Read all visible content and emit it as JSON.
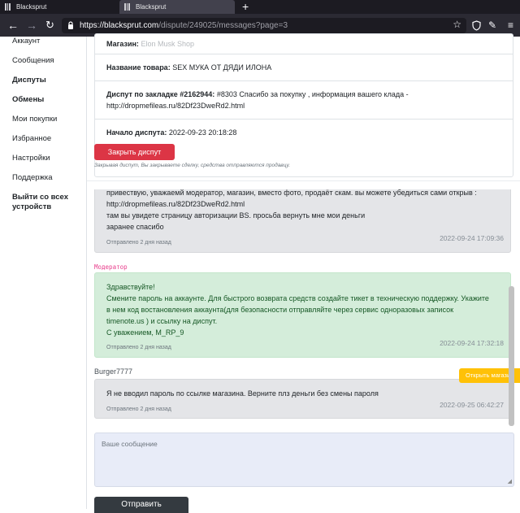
{
  "browser": {
    "tabs": [
      {
        "title": "Blacksprut"
      },
      {
        "title": "Blacksprut"
      }
    ],
    "url_host": "https://blacksprut.com",
    "url_path": "/dispute/249025/messages?page=3"
  },
  "sidebar": {
    "items": [
      {
        "label": "Аккаунт"
      },
      {
        "label": "Сообщения"
      },
      {
        "label": "Диспуты"
      },
      {
        "label": "Обмены"
      },
      {
        "label": "Мои покупки"
      },
      {
        "label": "Избранное"
      },
      {
        "label": "Настройки"
      },
      {
        "label": "Поддержка"
      },
      {
        "label": "Выйти со всех устройств"
      }
    ]
  },
  "dispute": {
    "shop_label": "Магазин:",
    "shop_value": "Elon Musk Shop",
    "product_label": "Название товара:",
    "product_value": "SEX МУКА ОТ ДЯДИ ИЛОНА",
    "bookmark_label": "Диспут по закладке #2162944:",
    "bookmark_value": "#8303 Спасибо за покупку , информация вашего клада - http://dropmefileas.ru/82Df23DweRd2.html",
    "start_label": "Начало диспута:",
    "start_value": "2022-09-23 20:18:28",
    "close_button": "Закрыть диспут",
    "close_hint": "Закрывая диспут, Вы закрываете сделку, средства отправляются продавцу."
  },
  "messages": [
    {
      "lines": [
        "привествую, уважаемй модератор, магазин, вместо фото, продаёт скам. вы можете убедиться сами открыв :",
        "http://dropmefileas.ru/82Df23DweRd2.html",
        "там вы увидете страницу авторизации BS. просьба вернуть мне мои деньги",
        "заранее спасибо"
      ],
      "status": "Отправлено 2 дня назад",
      "date": "2022-09-24 17:09:36"
    },
    {
      "author": "Модератор",
      "lines": [
        "Здравствуйте!",
        "Смените пароль на аккаунте. Для быстрого возврата средств создайте тикет в техническую поддержку. Укажите",
        "в нем код востановления аккаунта(для безопасности отправляйте через сервис одноразовых записок",
        "timenote.us ) и ссылку на диспут.",
        "С уважением, M_RP_9"
      ],
      "status": "Отправлено 2 дня назад",
      "date": "2022-09-24 17:32:18"
    },
    {
      "author": "Burger7777",
      "lines": [
        "Я не вводил пароль по ссылке магазина. Верните плз деньги без смены пароля"
      ],
      "status": "Отправлено 2 дня назад",
      "date": "2022-09-25 06:42:27"
    }
  ],
  "open_store_button": "Открыть магазин",
  "compose": {
    "placeholder": "Ваше сообщение",
    "send_button": "Отправить"
  }
}
